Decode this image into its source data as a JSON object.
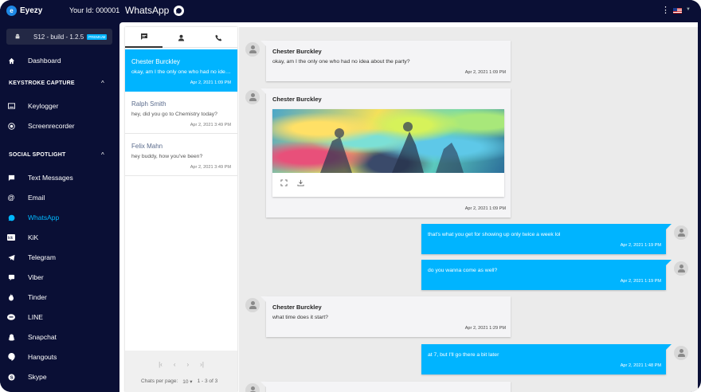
{
  "app": {
    "logo_text": "Eyezy",
    "logo_mark": "e",
    "user_id": "Your Id: 000001",
    "page_title": "WhatsApp"
  },
  "device": {
    "label": "S12 - build - 1.2.5",
    "badge": "PREMIUM"
  },
  "nav": {
    "dashboard": "Dashboard",
    "section_keystroke": "KEYSTROKE CAPTURE",
    "keylogger": "Keylogger",
    "screenrecorder": "Screenrecorder",
    "section_social": "SOCIAL SPOTLIGHT",
    "text_messages": "Text Messages",
    "email": "Email",
    "whatsapp": "WhatsApp",
    "kik": "KiK",
    "telegram": "Telegram",
    "viber": "Viber",
    "tinder": "Tinder",
    "line": "LINE",
    "snapchat": "Snapchat",
    "hangouts": "Hangouts",
    "skype": "Skype"
  },
  "icons": {
    "dashboard": "home-icon",
    "keylogger": "keyboard-icon",
    "screenrecorder": "record-icon",
    "text_messages": "message-icon",
    "email": "at-icon",
    "whatsapp": "whatsapp-icon",
    "kik": "kik-icon",
    "telegram": "telegram-icon",
    "viber": "viber-icon",
    "tinder": "tinder-icon",
    "line": "line-icon",
    "snapchat": "snapchat-icon",
    "hangouts": "hangouts-icon",
    "skype": "skype-icon"
  },
  "colors": {
    "accent": "#00b4ff",
    "sidebar_bg": "#0a0f35",
    "incoming_bg": "#f4f4f6"
  },
  "chats": [
    {
      "name": "Chester Burckley",
      "preview": "okay, am I the only one who had no idea about the party?",
      "time": "Apr 2, 2021 1:09 PM"
    },
    {
      "name": "Ralph Smith",
      "preview": "hey, did you go to Chemistry today?",
      "time": "Apr 2, 2021 3:49 PM"
    },
    {
      "name": "Felix Mahn",
      "preview": "hey buddy, how you've been?",
      "time": "Apr 2, 2021 3:49 PM"
    }
  ],
  "pager": {
    "first": "|‹",
    "prev": "‹",
    "next": "›",
    "last": "›|",
    "per_page_label": "Chats per page:",
    "per_page": "10 ▾",
    "range": "1 - 3 of 3"
  },
  "messages": [
    {
      "dir": "in",
      "sender": "Chester Burckley",
      "text": "okay, am I the only one who had no idea about the party?",
      "time": "Apr 2, 2021 1:09 PM"
    },
    {
      "dir": "in",
      "sender": "Chester Burckley",
      "text": "",
      "time": "Apr 2, 2021 1:09 PM"
    },
    {
      "dir": "out",
      "text": "that's what you get for showing up only twice a week lol",
      "time": "Apr 2, 2021 1:19 PM"
    },
    {
      "dir": "out",
      "text": "do you wanna come as well?",
      "time": "Apr 2, 2021 1:19 PM"
    },
    {
      "dir": "in",
      "sender": "Chester Burckley",
      "text": "what time does it start?",
      "time": "Apr 2, 2021 1:29 PM"
    },
    {
      "dir": "out",
      "text": "at 7, but I'll go there a bit later",
      "time": "Apr 2, 2021 1:48 PM"
    }
  ]
}
